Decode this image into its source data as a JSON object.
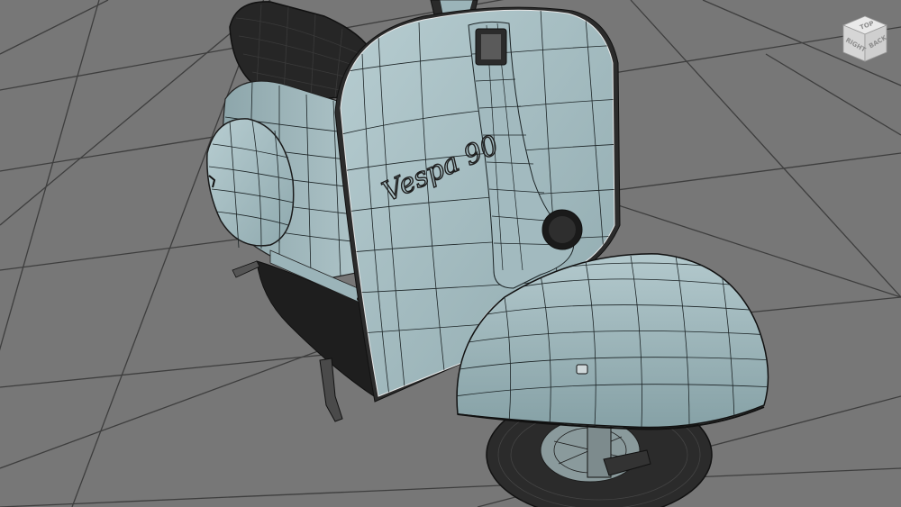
{
  "viewport": {
    "background_color": "#777777",
    "grid_color": "#3e3e3e",
    "mesh_color": "#a9c2c6",
    "mesh_shadow_color": "#7f9a9f",
    "wire_color": "#1c2426",
    "dark_part_color": "#2a2a2a"
  },
  "model": {
    "badge_text": "Vespa 90"
  },
  "viewcube": {
    "faces": [
      "TOP",
      "RIGHT",
      "BACK"
    ],
    "icon": "viewcube-icon"
  }
}
